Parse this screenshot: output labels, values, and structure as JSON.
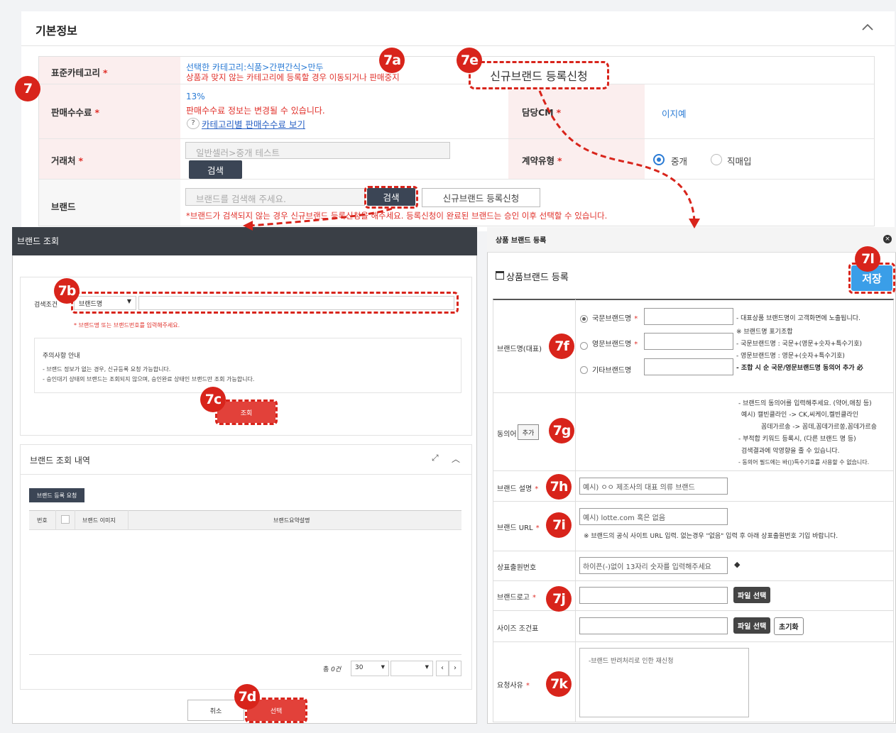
{
  "section": {
    "title": "기본정보"
  },
  "form": {
    "category": {
      "label": "표준카테고리",
      "selected": "선택한 카테고리:식품>간편간식>만두",
      "warning": "상품과 맞지 않는 카테고리에 등록할 경우 이동되거나 판매중지"
    },
    "commission": {
      "label": "판매수수료",
      "rate": "13%",
      "note": "판매수수료 정보는 변경될 수 있습니다.",
      "link": "카테고리별 판매수수료 보기"
    },
    "md": {
      "label": "담당CM",
      "value": "이지예"
    },
    "vendor": {
      "label": "거래처",
      "value": "일반셀러>중개 테스트",
      "search": "검색"
    },
    "contract": {
      "label": "계약유형",
      "options": [
        "중개",
        "직매입"
      ],
      "selected": "중개"
    },
    "brand": {
      "label": "브랜드",
      "placeholder": "브랜드를 검색해 주세요.",
      "search": "검색",
      "new_request": "신규브랜드 등록신청",
      "notice": "*브랜드가 검색되지 않는 경우 신규브랜드 등록신청을 해주세요. 등록신청이 완료된 브랜드는 승인 이후 선택할 수 있습니다."
    },
    "required_mark": "*",
    "new_brand_callout": "신규브랜드 등록신청"
  },
  "annotations": [
    "7",
    "7a",
    "7b",
    "7c",
    "7d",
    "7e",
    "7f",
    "7g",
    "7h",
    "7i",
    "7j",
    "7k",
    "7l"
  ],
  "brand_search_modal": {
    "title": "브랜드 조회",
    "condition_label": "검색조건",
    "condition_select": "브랜드명",
    "hint": "* 브랜드명 또는 브랜드번호를 입력해주세요.",
    "notice_title": "주의사항 안내",
    "notice_lines": [
      "- 브랜드 정보가 없는 경우, 신규등록 요청 가능합니다.",
      "- 승인대기 상태의 브랜드는 조회되지 않으며, 승인완료 상태인 브랜드만 조회 가능합니다."
    ],
    "search_btn": "조회",
    "results_title": "브랜드 조회 내역",
    "register_btn": "브랜드 등록 요청",
    "columns": [
      "번호",
      "브랜드 이미지",
      "브랜드요약설명"
    ],
    "total_prefix": "총",
    "total_count": "0",
    "total_suffix": "건",
    "page_size": "30",
    "cancel": "취소",
    "select": "선택"
  },
  "brand_register_modal": {
    "title": "상품 브랜드 등록",
    "heading": "상품브랜드 등록",
    "save": "저장",
    "name_label": "브랜드명(대표)",
    "name_options": [
      "국문브랜드명",
      "영문브랜드명",
      "기타브랜드명"
    ],
    "name_notes": [
      "- 대표상품 브랜드명이 고객화면에 노출됩니다.",
      "※ 브랜드명 표기조합",
      "- 국문브랜드명 : 국문+(영문+숫자+특수기호)",
      "- 영문브랜드명 : 영문+(숫자+특수기호)",
      "- 조합 시 순 국문/영문브랜드명 동의어 추가 必"
    ],
    "synonym_label": "동의어",
    "synonym_add": "추가",
    "synonym_notes": [
      "- 브랜드의 동의어를 입력해주세요. (약어,애칭 등)",
      "예시) 캘빈클라인 -> CK,씨케이,켈빈클라인",
      "꼼데가르송 -> 꼼데,꼼데가르쏭,꼼데가르숑",
      "- 부적합 키워드 등록시, (다른 브랜드 명 등)",
      "검색결과에 악영향을 줄 수 있습니다.",
      "- 동의어 필드에는 바(|)특수기호를 사용할 수 없습니다."
    ],
    "desc_label": "브랜드 설명",
    "desc_placeholder": "예시) ㅇㅇ 제조사의 대표 의류 브랜드",
    "url_label": "브랜드 URL",
    "url_placeholder": "예시) lotte.com 혹은 없음",
    "url_note": "※ 브랜드의 공식 사이트 URL 입력. 없는경우 \"없음\" 입력 후 아래 상표출원번호 기입 바랍니다.",
    "tm_label": "상표출원번호",
    "tm_placeholder": "하이픈(-)없이 13자리 숫자를 입력해주세요",
    "logo_label": "브랜드로고",
    "size_label": "사이즈 조건표",
    "file_btn": "파일 선택",
    "reset_btn": "초기화",
    "reason_label": "요청사유",
    "reason_value": "-브랜드 반려처리로 인한 재신청"
  }
}
